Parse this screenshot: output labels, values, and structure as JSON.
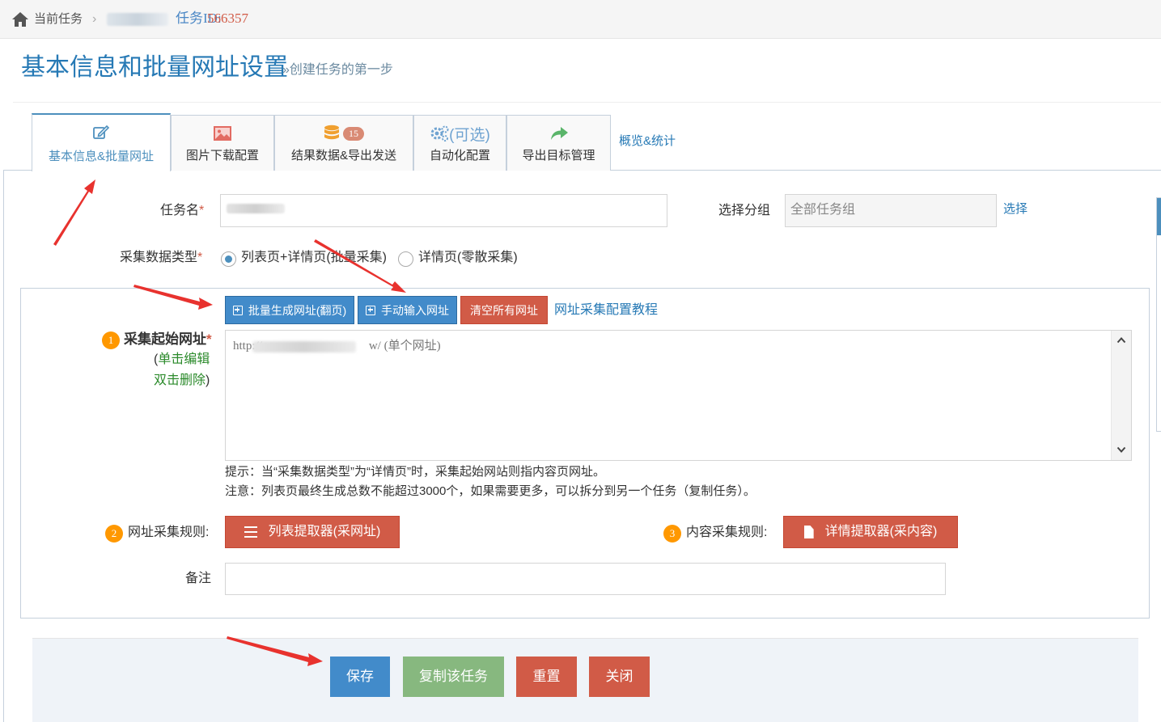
{
  "breadcrumb": {
    "home_label": "当前任务",
    "separator": "›",
    "task_id_label": "任务ID:",
    "task_id_value": "566357"
  },
  "header": {
    "title": "基本信息和批量网址设置",
    "subtitle": "»创建任务的第一步"
  },
  "tabs": [
    {
      "label": "基本信息&批量网址",
      "icon": "edit-icon",
      "active": true
    },
    {
      "label": "图片下载配置",
      "icon": "image-icon",
      "active": false
    },
    {
      "label": "结果数据&导出发送",
      "icon": "database-icon",
      "badge": "15",
      "active": false
    },
    {
      "label": "自动化配置",
      "icon": "gears-icon",
      "optional": "(可选)",
      "active": false
    },
    {
      "label": "导出目标管理",
      "icon": "share-icon",
      "active": false
    }
  ],
  "tab_link": "概览&统计",
  "form": {
    "task_name_label": "任务名",
    "required_mark": "*",
    "group_label": "选择分组",
    "group_value": "全部任务组",
    "group_select_link": "选择",
    "data_type_label": "采集数据类型",
    "data_type_options": [
      {
        "label": "列表页+详情页(批量采集)",
        "checked": true
      },
      {
        "label": "详情页(零散采集)",
        "checked": false
      }
    ]
  },
  "url_panel": {
    "buttons": {
      "batch_generate": "批量生成网址(翻页)",
      "manual_input": "手动输入网址",
      "clear_all": "清空所有网址"
    },
    "tutorial_link": "网址采集配置教程",
    "start_url": {
      "step": "1",
      "label": "采集起始网址",
      "hint_open": "(",
      "hint_click": "单击编辑",
      "hint_dblclick": "双击删除",
      "hint_close": ")"
    },
    "url_entry": {
      "prefix": "http://",
      "suffix": "w/",
      "note": "(单个网址)"
    },
    "notes": [
      "提示：当“采集数据类型”为“详情页”时，采集起始网站则指内容页网址。",
      "注意：列表页最终生成总数不能超过3000个，如果需要更多，可以拆分到另一个任务（复制任务）。"
    ],
    "url_rule": {
      "step": "2",
      "label": "网址采集规则:",
      "button": "列表提取器(采网址)"
    },
    "content_rule": {
      "step": "3",
      "label": "内容采集规则:",
      "button": "详情提取器(采内容)"
    },
    "remark_label": "备注",
    "remark_value": ""
  },
  "footer": {
    "save": "保存",
    "copy": "复制该任务",
    "reset": "重置",
    "close": "关闭"
  },
  "colors": {
    "primary": "#428bca",
    "danger": "#d15b47",
    "success": "#87b87f",
    "title": "#2679b5",
    "badge": "#ff9800",
    "annotation_arrow": "#e8322e"
  }
}
